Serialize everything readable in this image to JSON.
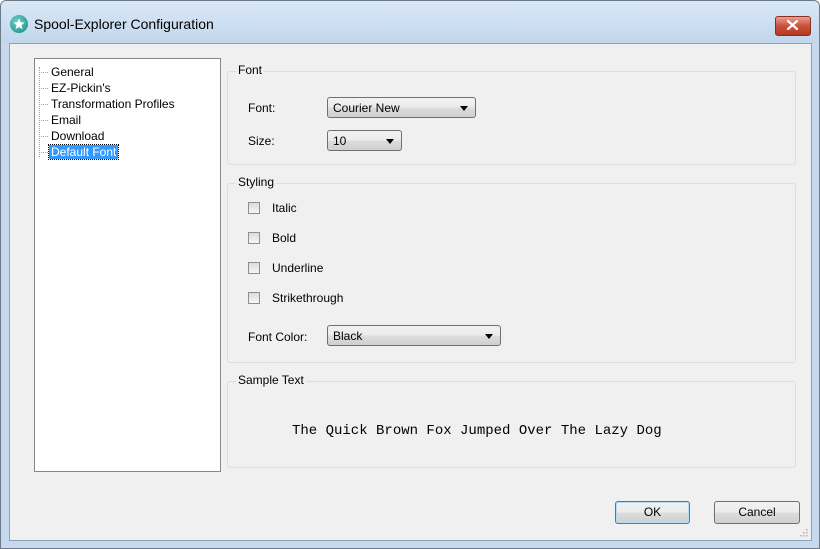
{
  "window": {
    "title": "Spool-Explorer Configuration",
    "app_icon": "star-app-icon",
    "close_icon": "close-icon"
  },
  "nav": {
    "items": [
      {
        "label": "General",
        "selected": false
      },
      {
        "label": "EZ-Pickin's",
        "selected": false
      },
      {
        "label": "Transformation Profiles",
        "selected": false
      },
      {
        "label": "Email",
        "selected": false
      },
      {
        "label": "Download",
        "selected": false
      },
      {
        "label": "Default Font",
        "selected": true
      }
    ]
  },
  "font_group": {
    "title": "Font",
    "font_label": "Font:",
    "font_value": "Courier New",
    "size_label": "Size:",
    "size_value": "10"
  },
  "styling_group": {
    "title": "Styling",
    "options": [
      {
        "label": "Italic",
        "checked": false
      },
      {
        "label": "Bold",
        "checked": false
      },
      {
        "label": "Underline",
        "checked": false
      },
      {
        "label": "Strikethrough",
        "checked": false
      }
    ],
    "color_label": "Font Color:",
    "color_value": "Black"
  },
  "sample_group": {
    "title": "Sample Text",
    "text": "The Quick Brown Fox Jumped Over The Lazy Dog"
  },
  "buttons": {
    "ok": "OK",
    "cancel": "Cancel"
  },
  "colors": {
    "selection": "#3399ff",
    "title_bar": "#c6d9ee",
    "close_button": "#c8513b"
  }
}
